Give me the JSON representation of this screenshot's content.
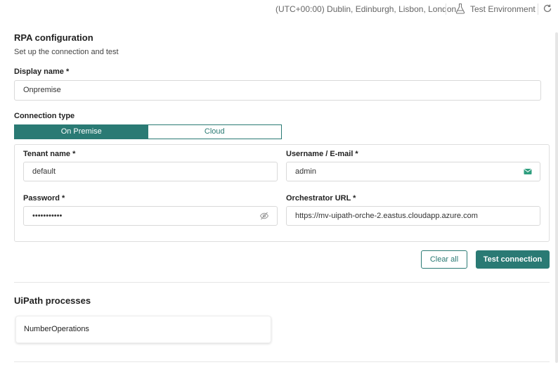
{
  "header": {
    "timezone": "(UTC+00:00) Dublin, Edinburgh, Lisbon, London",
    "environment": "Test Environment"
  },
  "form": {
    "title": "RPA configuration",
    "subtitle": "Set up the connection and test",
    "display_name_label": "Display name *",
    "display_name_value": "Onpremise",
    "connection_type_label": "Connection type",
    "connection_types": [
      "On Premise",
      "Cloud"
    ],
    "selected_connection_type": "On Premise",
    "tenant_label": "Tenant name *",
    "tenant_value": "default",
    "username_label": "Username / E-mail *",
    "username_value": "admin",
    "password_label": "Password *",
    "password_value": "•••••••••••",
    "orchestrator_label": "Orchestrator URL *",
    "orchestrator_value": "https://mv-uipath-orche-2.eastus.cloudapp.azure.com",
    "clear_label": "Clear all",
    "test_label": "Test connection"
  },
  "processes": {
    "title": "UiPath processes",
    "items": [
      "NumberOperations"
    ]
  },
  "colors": {
    "accent": "#2a7a74",
    "icon_green": "#2e9e7e"
  }
}
